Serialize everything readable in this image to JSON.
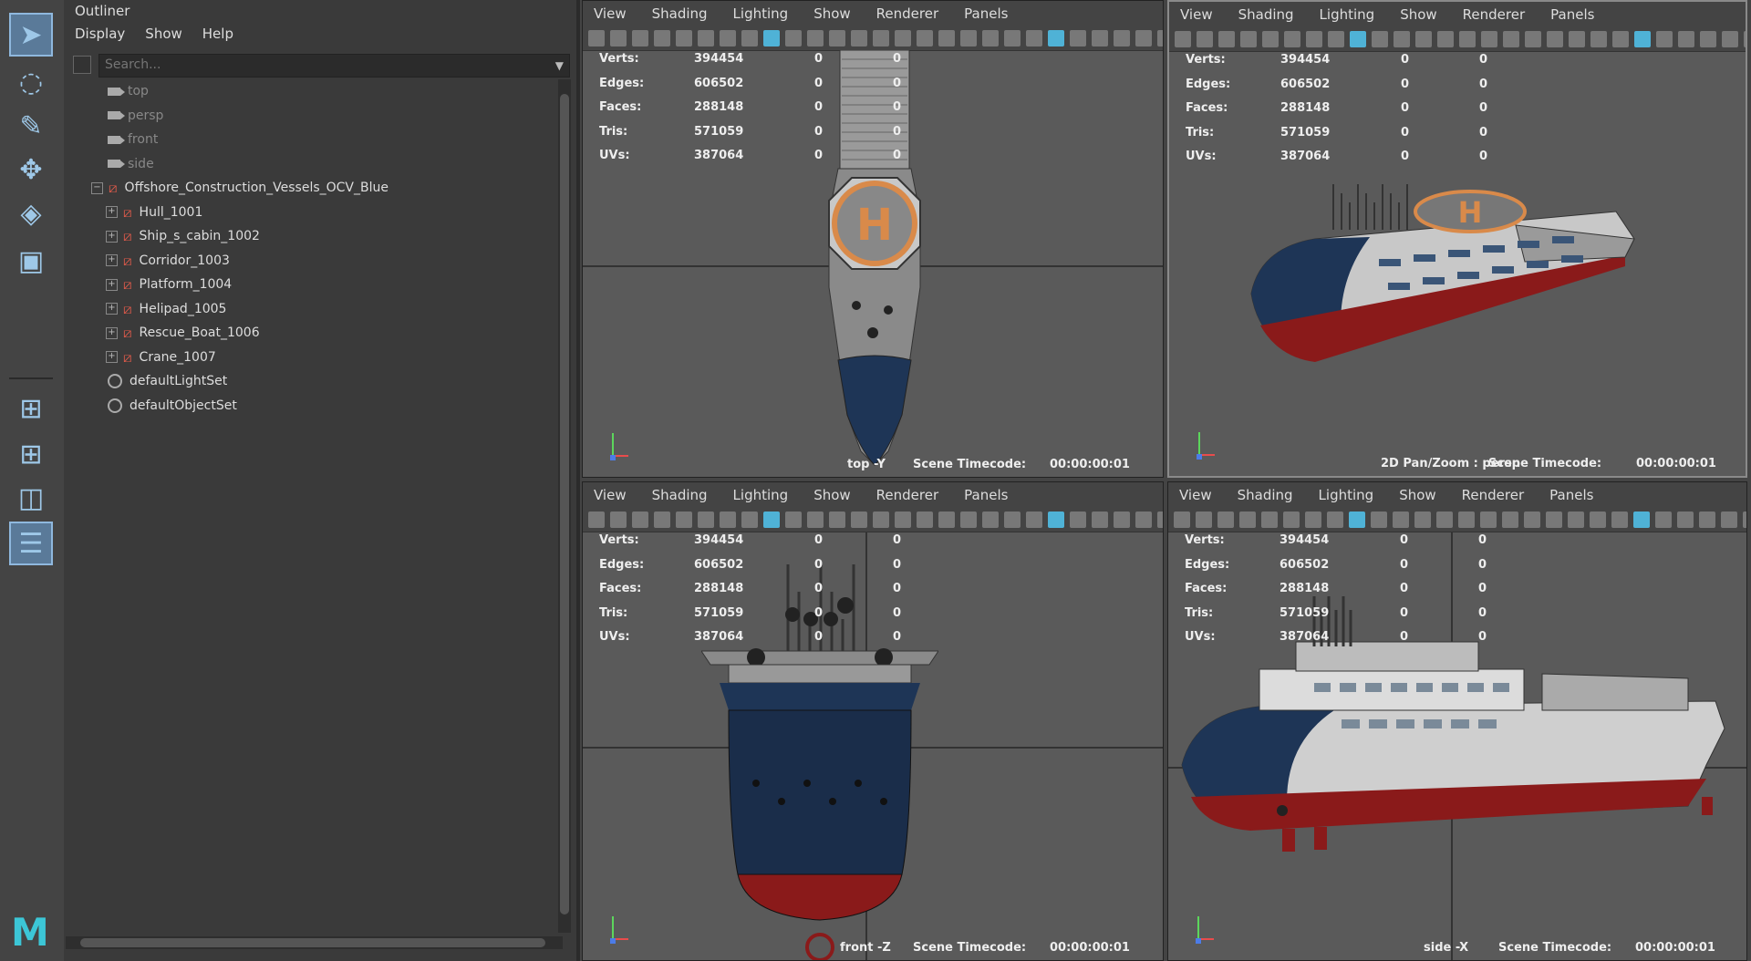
{
  "toolbox": {
    "tools": [
      "select-tool-icon",
      "lasso-tool-icon",
      "paint-select-tool-icon",
      "move-tool-icon",
      "rotate-tool-icon",
      "scale-tool-icon"
    ],
    "layouts": [
      "single-view-layout-icon",
      "four-view-layout-icon",
      "two-view-layout-icon",
      "outliner-layout-icon"
    ]
  },
  "outliner": {
    "title": "Outliner",
    "menu": [
      "Display",
      "Show",
      "Help"
    ],
    "search_placeholder": "Search...",
    "cameras": [
      "top",
      "persp",
      "front",
      "side"
    ],
    "group": {
      "name": "Offshore_Construction_Vessels_OCV_Blue",
      "children": [
        "Hull_1001",
        "Ship_s_cabin_1002",
        "Corridor_1003",
        "Platform_1004",
        "Helipad_1005",
        "Rescue_Boat_1006",
        "Crane_1007"
      ]
    },
    "sets": [
      "defaultLightSet",
      "defaultObjectSet"
    ]
  },
  "viewport_menu": [
    "View",
    "Shading",
    "Lighting",
    "Show",
    "Renderer",
    "Panels"
  ],
  "stats": {
    "labels": [
      "Verts:",
      "Edges:",
      "Faces:",
      "Tris:",
      "UVs:"
    ],
    "values": [
      "394454",
      "606502",
      "288148",
      "571059",
      "387064"
    ],
    "sel": [
      "0",
      "0",
      "0",
      "0",
      "0"
    ],
    "extra": [
      "0",
      "0",
      "0",
      "0",
      "0"
    ]
  },
  "viewports": {
    "top": {
      "label": "top -Y",
      "timecode_label": "Scene Timecode:",
      "timecode": "00:00:00:01"
    },
    "persp": {
      "label": "2D Pan/Zoom : persp",
      "timecode_label": "Scene Timecode:",
      "timecode": "00:00:00:01"
    },
    "front": {
      "label": "front -Z",
      "timecode_label": "Scene Timecode:",
      "timecode": "00:00:00:01"
    },
    "side": {
      "label": "side -X",
      "timecode_label": "Scene Timecode:",
      "timecode": "00:00:00:01"
    }
  },
  "helipad_letter": "H",
  "colors": {
    "hull_blue": "#1e3556",
    "hull_red": "#8a1a1a",
    "helipad_orange": "#d98a4a",
    "accent": "#4fb2d6"
  }
}
